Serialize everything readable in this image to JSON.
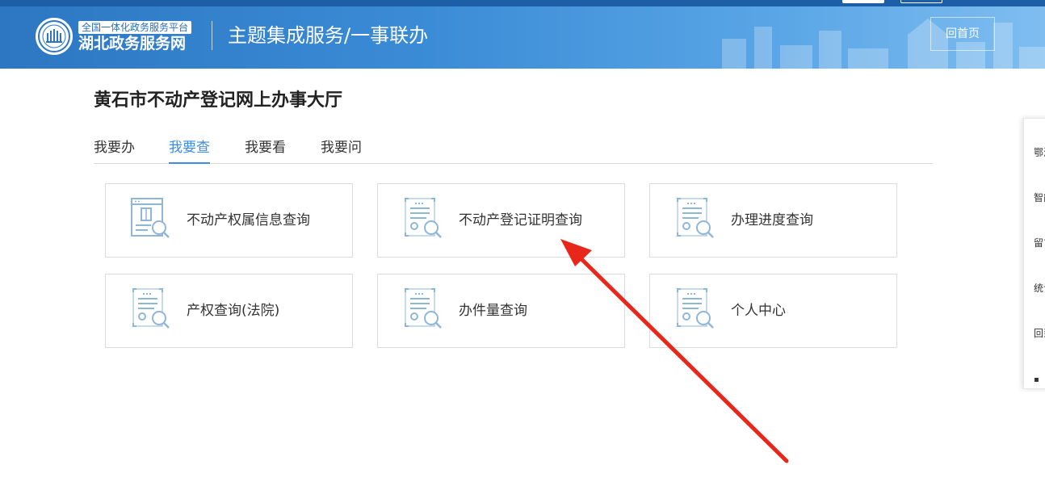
{
  "header": {
    "brand_top": "全国一体化政务服务平台",
    "brand_main": "湖北政务服务网",
    "title": "主题集成服务/一事联办",
    "home_button": "回首页"
  },
  "main": {
    "page_title": "黄石市不动产登记网上办事大厅",
    "tabs": [
      {
        "label": "我要办"
      },
      {
        "label": "我要查",
        "active": true
      },
      {
        "label": "我要看"
      },
      {
        "label": "我要问"
      }
    ],
    "cards": [
      {
        "label": "不动产权属信息查询",
        "icon": "property-info-search-icon"
      },
      {
        "label": "不动产登记证明查询",
        "icon": "certificate-search-icon"
      },
      {
        "label": "办理进度查询",
        "icon": "certificate-search-icon"
      },
      {
        "label": "产权查询(法院)",
        "icon": "certificate-search-icon"
      },
      {
        "label": "办件量查询",
        "icon": "certificate-search-icon"
      },
      {
        "label": "个人中心",
        "icon": "certificate-search-icon"
      }
    ]
  },
  "float_sidebar": {
    "items": [
      {
        "label": "鄂汇"
      },
      {
        "label": "智能"
      },
      {
        "label": "留言"
      },
      {
        "label": "统计"
      },
      {
        "label": "回到"
      }
    ]
  },
  "colors": {
    "header_blue": "#3a8bd6",
    "active_tab": "#3a8ee6",
    "icon_blue": "#8fb6d9",
    "annotation_red": "#e8261a"
  }
}
